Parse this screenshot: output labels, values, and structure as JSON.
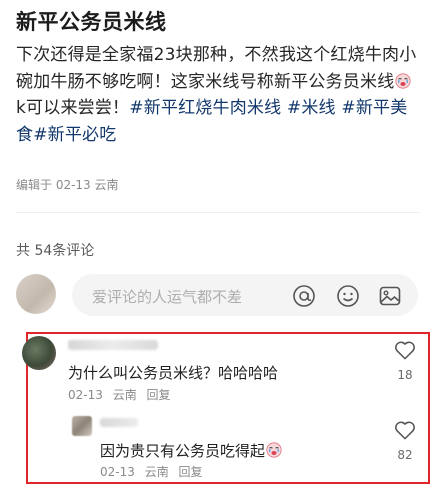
{
  "post": {
    "title": "新平公务员米线",
    "body_part1": "下次还得是全家福23块那种，不然我这个红烧牛肉小碗加牛肠不够吃啊！这家米线号称新平公务员米线",
    "body_part2": "k可以来尝尝！",
    "hashtags": [
      "#新平红烧牛肉米线",
      "#米线",
      "#新平美食",
      "#新平必吃"
    ],
    "meta": "编辑于 02-13 云南"
  },
  "comments_section": {
    "count_label": "共 54条评论",
    "input_placeholder": "爱评论的人运气都不差"
  },
  "comments": [
    {
      "text": "为什么叫公务员米线？哈哈哈哈",
      "date": "02-13",
      "location": "云南",
      "reply_label": "回复",
      "likes": "18"
    },
    {
      "text": "因为贵只有公务员吃得起",
      "date": "02-13",
      "location": "云南",
      "reply_label": "回复",
      "likes": "82"
    }
  ],
  "colors": {
    "hashtag": "#13386c",
    "highlight_border": "#e0262b"
  },
  "icons": [
    "at-icon",
    "emoji-icon",
    "image-icon",
    "heart-icon",
    "crying-emoji-icon"
  ]
}
